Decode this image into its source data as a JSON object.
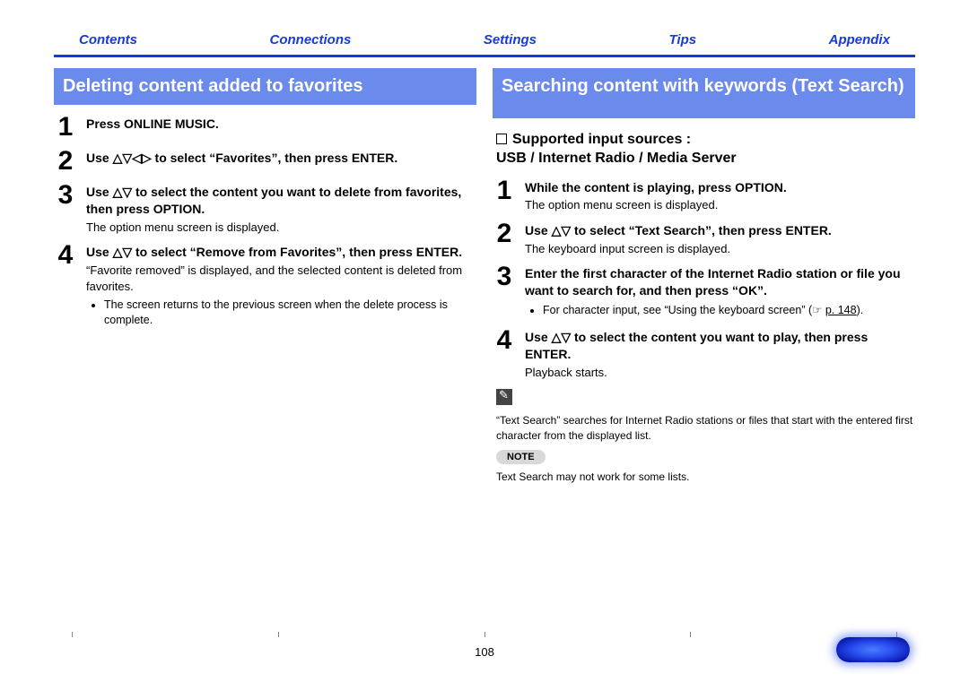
{
  "nav": {
    "contents": "Contents",
    "connections": "Connections",
    "settings": "Settings",
    "tips": "Tips",
    "appendix": "Appendix"
  },
  "left": {
    "title": "Deleting content added to favorites",
    "steps": [
      {
        "num": "1",
        "bold": "Press ONLINE MUSIC."
      },
      {
        "num": "2",
        "bold": "Use △▽◁▷ to select “Favorites”, then press ENTER."
      },
      {
        "num": "3",
        "bold": "Use △▽ to select the content you want to delete from favorites, then press OPTION.",
        "sub": "The option menu screen is displayed."
      },
      {
        "num": "4",
        "bold": "Use △▽ to select “Remove from Favorites”, then press ENTER.",
        "sub": "“Favorite removed” is displayed, and the selected content is deleted from favorites.",
        "bul": "The screen returns to the previous screen when the delete process is complete."
      }
    ]
  },
  "right": {
    "title": "Searching content with keywords (Text Search)",
    "supported_hdr": "Supported input sources :",
    "supported_val": "USB / Internet Radio / Media Server",
    "steps": [
      {
        "num": "1",
        "bold": "While the content is playing, press OPTION.",
        "sub": "The option menu screen is displayed."
      },
      {
        "num": "2",
        "bold": "Use △▽ to select “Text Search”, then press ENTER.",
        "sub": "The keyboard input screen is displayed."
      },
      {
        "num": "3",
        "bold": "Enter the first character of the Internet Radio station or file you want to search for, and then press “OK”.",
        "bul_a": "For character input, see “Using the keyboard screen” (☞",
        "bul_link": "p. 148",
        "bul_b": ")."
      },
      {
        "num": "4",
        "bold": "Use △▽ to select the content you want to play, then press ENTER.",
        "sub": "Playback starts."
      }
    ],
    "tip": "“Text Search” searches for Internet Radio stations or files that start with the entered first character from the displayed list.",
    "note_label": "NOTE",
    "note_text": "Text Search may not work for some lists."
  },
  "pagenum": "108"
}
